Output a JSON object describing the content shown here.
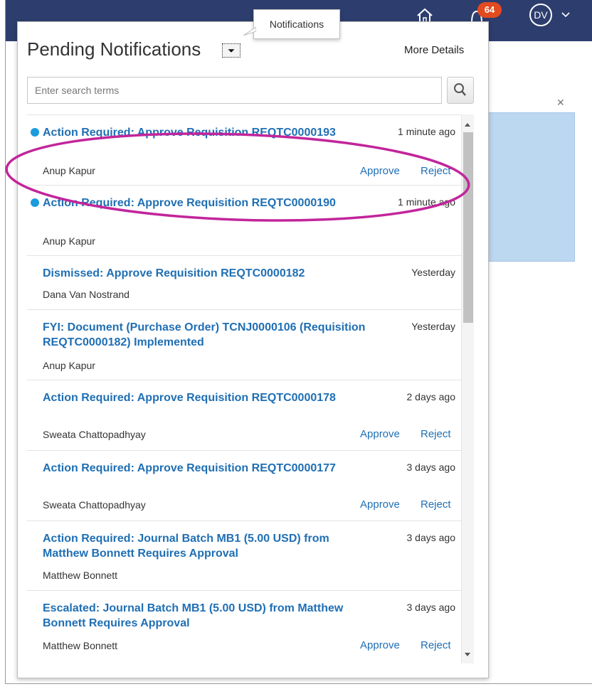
{
  "header": {
    "badge_count": "64",
    "avatar_initials": "DV"
  },
  "tooltip": {
    "text": "Notifications"
  },
  "popup": {
    "title": "Pending Notifications",
    "more_details": "More Details",
    "search_placeholder": "Enter search terms",
    "items": [
      {
        "title": "Action Required: Approve Requisition REQTC0000193",
        "time": "1 minute ago",
        "from": "Anup Kapur",
        "unread": true,
        "approve": "Approve",
        "reject": "Reject"
      },
      {
        "title": "Action Required: Approve Requisition REQTC0000190",
        "time": "1 minute ago",
        "from": "Anup Kapur",
        "unread": true
      },
      {
        "title": "Dismissed: Approve Requisition REQTC0000182",
        "time": "Yesterday",
        "from": "Dana Van Nostrand"
      },
      {
        "title": "FYI: Document (Purchase Order) TCNJ0000106 (Requisition REQTC0000182) Implemented",
        "time": "Yesterday",
        "from": "Anup Kapur"
      },
      {
        "title": "Action Required: Approve Requisition REQTC0000178",
        "time": "2 days ago",
        "from": "Sweata Chattopadhyay",
        "approve": "Approve",
        "reject": "Reject"
      },
      {
        "title": "Action Required: Approve Requisition REQTC0000177",
        "time": "3 days ago",
        "from": "Sweata Chattopadhyay",
        "approve": "Approve",
        "reject": "Reject"
      },
      {
        "title": "Action Required: Journal Batch MB1 (5.00 USD) from Matthew Bonnett Requires Approval",
        "time": "3 days ago",
        "from": "Matthew Bonnett"
      },
      {
        "title": "Escalated: Journal Batch MB1 (5.00 USD) from Matthew Bonnett Requires Approval",
        "time": "3 days ago",
        "from": "Matthew Bonnett",
        "approve": "Approve",
        "reject": "Reject"
      }
    ]
  },
  "colors": {
    "header_bg": "#2d3e6e",
    "link": "#1f6fb4",
    "unread_dot": "#1a9bdc",
    "badge": "#e24b1f",
    "highlight": "#c2259b"
  }
}
